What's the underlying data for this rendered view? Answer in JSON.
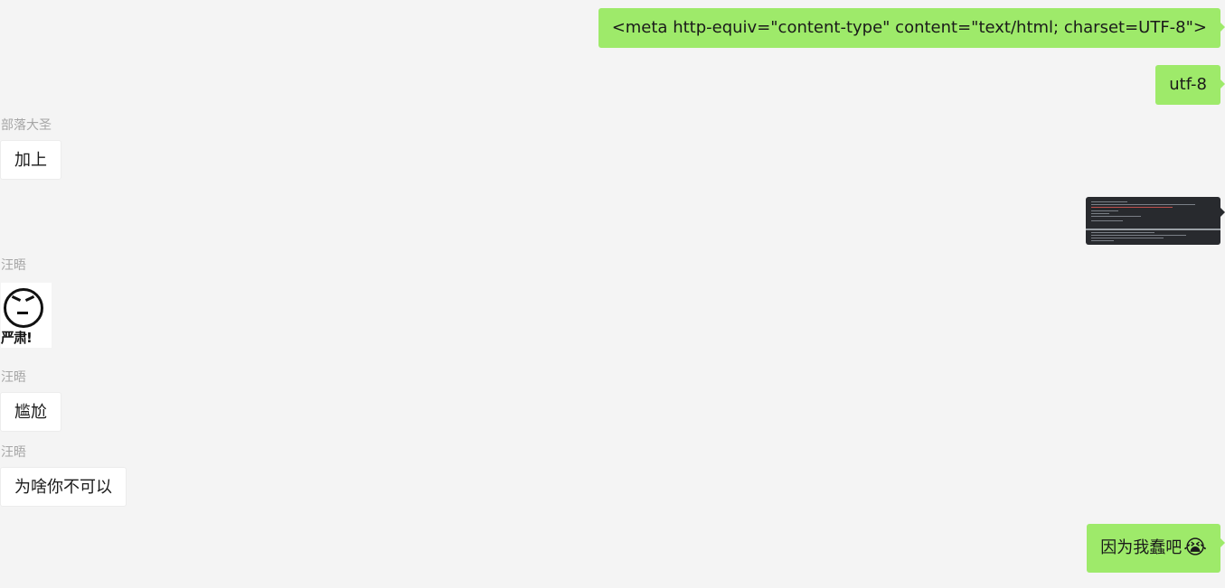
{
  "messages": [
    {
      "dir": "out",
      "text": "<meta http-equiv=\"content-type\" content=\"text/html; charset=UTF-8\">"
    },
    {
      "dir": "out",
      "text": "utf-8"
    },
    {
      "dir": "in",
      "sender": "部落大圣",
      "text": "加上"
    },
    {
      "dir": "out",
      "type": "image",
      "icon": "code-screenshot-thumbnail"
    },
    {
      "dir": "in",
      "sender": "汪晤",
      "type": "sticker",
      "caption": "严肃!"
    },
    {
      "dir": "in",
      "sender": "汪晤",
      "text": "尴尬"
    },
    {
      "dir": "in",
      "sender": "汪晤",
      "text": "为啥你不可以"
    },
    {
      "dir": "out",
      "text": "因为我蠢吧",
      "emoji": "😭"
    }
  ],
  "colors": {
    "background": "#f4f4f4",
    "outgoing_bubble": "#9eea6a",
    "incoming_bubble": "#ffffff",
    "sender_name": "#a6a6a6"
  }
}
